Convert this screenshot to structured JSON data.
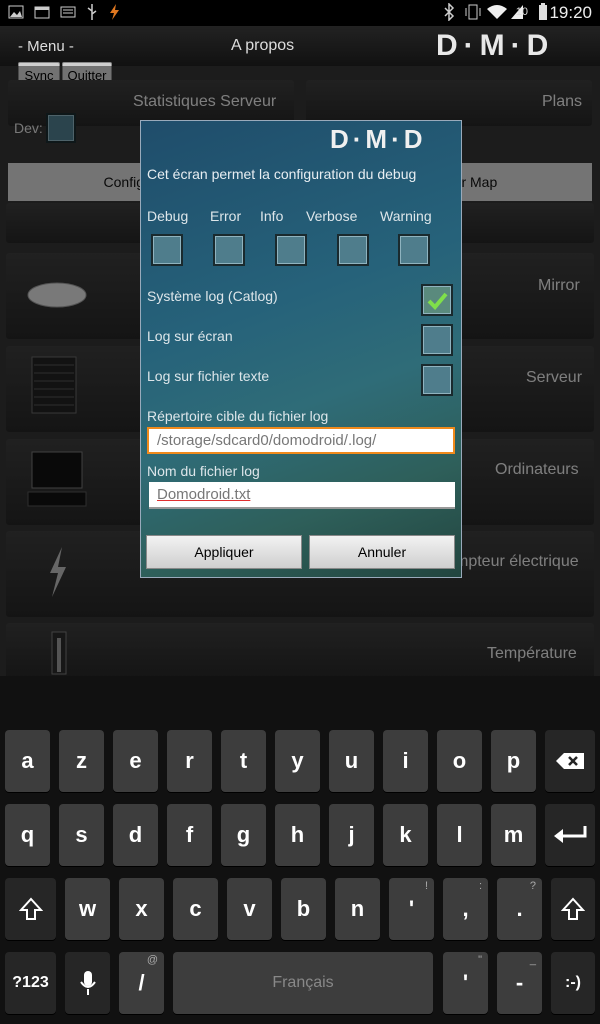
{
  "statusbar": {
    "time": "19:20",
    "battery_text": "10"
  },
  "appbar": {
    "menu_label": "- Menu -",
    "title": "A propos",
    "brand": "D·M·D"
  },
  "background": {
    "sync_label": "Sync",
    "quit_label": "Quitter",
    "dev_label": "Dev:",
    "stats_label": "Statistiques Serveur",
    "plans_label": "Plans",
    "config_left_label": "Configuration g",
    "config_map_label": "Configurer Map",
    "tiles": [
      {
        "label": "Mirror"
      },
      {
        "label": "Serveur"
      },
      {
        "label": "Ordinateurs"
      },
      {
        "label": "mpteur électrique"
      },
      {
        "label": "Température"
      }
    ]
  },
  "dialog": {
    "logo": "D·M·D",
    "intro": "Cet écran permet la configuration du debug",
    "levels": [
      {
        "label": "Debug",
        "checked": false
      },
      {
        "label": "Error",
        "checked": false
      },
      {
        "label": "Info",
        "checked": false
      },
      {
        "label": "Verbose",
        "checked": false
      },
      {
        "label": "Warning",
        "checked": false
      }
    ],
    "options": [
      {
        "label": "Système log (Catlog)",
        "checked": true
      },
      {
        "label": "Log sur écran",
        "checked": false
      },
      {
        "label": "Log sur fichier texte",
        "checked": false
      }
    ],
    "dir_label": "Répertoire cible du fichier log",
    "dir_value": "/storage/sdcard0/domodroid/.log/",
    "name_label": "Nom du fichier log",
    "name_value": "Domodroid.txt",
    "apply_label": "Appliquer",
    "cancel_label": "Annuler"
  },
  "keyboard": {
    "row1": [
      "a",
      "z",
      "e",
      "r",
      "t",
      "y",
      "u",
      "i",
      "o",
      "p"
    ],
    "row2": [
      "q",
      "s",
      "d",
      "f",
      "g",
      "h",
      "j",
      "k",
      "l",
      "m"
    ],
    "row3": [
      "w",
      "x",
      "c",
      "v",
      "b",
      "n",
      "'",
      ",",
      "."
    ],
    "row3_hints": [
      "",
      "",
      "",
      "",
      "",
      "",
      "!",
      ":",
      "?"
    ],
    "sym_label": "?123",
    "slash": "/",
    "slash_hint": "@",
    "space_label": "Français",
    "apos": "'",
    "apos_hint": "\"",
    "dash": "-",
    "dash_hint": "_",
    "smiley": ":-)"
  }
}
